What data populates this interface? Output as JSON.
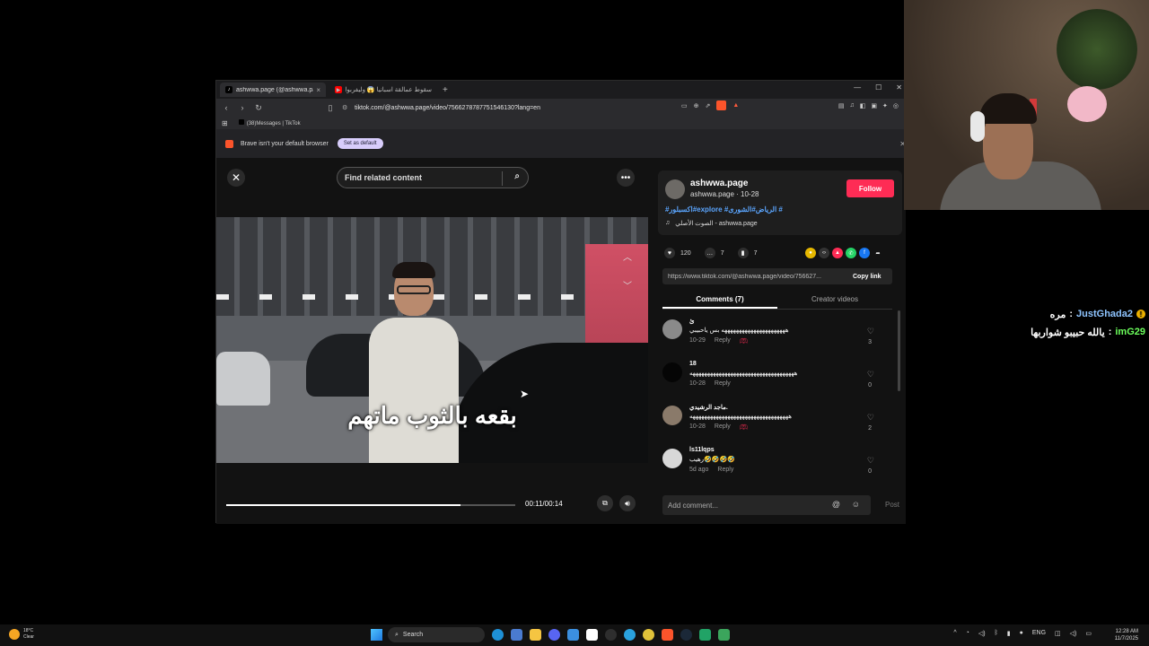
{
  "browser": {
    "tabs": [
      {
        "title": "ashwwa.page (@ashwwa.pa",
        "active": true
      },
      {
        "title": "سقوط عمالقة اسبانيا 😱 وليفربول يقد",
        "active": false
      }
    ],
    "new_tab": "+",
    "url": "tiktok.com/@ashwwa.page/video/7566278787751546130?lang=en",
    "bookmark": "(38)Messages | TikTok",
    "default_banner": {
      "message": "Brave isn't your default browser",
      "button": "Set as default"
    }
  },
  "video": {
    "search_placeholder": "Find related content",
    "caption": "بقعه بالثوب ماتهم",
    "time": "00:11/00:14",
    "progress": 0.81
  },
  "author": {
    "username": "ashwwa.page",
    "submeta": "ashwwa.page · 10-28",
    "follow_label": "Follow",
    "hashtags": "#اكسبلور#explore #الرياض#الشورى #",
    "sound": "الصوت الأصلي - ashwwa.page"
  },
  "stats": {
    "likes": "120",
    "comments": "7",
    "saves": "7"
  },
  "share": {
    "link": "https://www.tiktok.com/@ashwwa.page/video/756627...",
    "copy_label": "Copy link"
  },
  "panel_tabs": [
    {
      "label": "Comments (7)",
      "active": true
    },
    {
      "label": "Creator videos",
      "active": false
    }
  ],
  "comments": [
    {
      "name": "ئ",
      "text": "ههههههههههههههههههههههه بس ياحبيبي",
      "date": "10-29",
      "reply": "Reply",
      "likes": "3",
      "avatar_color": "#8a8a8a"
    },
    {
      "name": "18",
      "text": "ههههههههههههههههههههههههههههههههههههه",
      "date": "10-28",
      "reply": "Reply",
      "likes": "0",
      "avatar_color": "#050505"
    },
    {
      "name": "ماجد الرشيدي.",
      "text": "ههههههههههههههههههههههههههههههههههه",
      "date": "10-28",
      "reply": "Reply",
      "likes": "2",
      "avatar_color": "#8a7a6a"
    },
    {
      "name": "ls11lqps",
      "text": "رهيب🤣🤣🤣🤣",
      "date": "5d ago",
      "reply": "Reply",
      "likes": "0",
      "avatar_color": "#d8d8d8"
    }
  ],
  "comment_input": {
    "placeholder": "Add comment...",
    "post": "Post"
  },
  "chat": [
    {
      "user": "JustGhada2",
      "sep": " : ",
      "msg": "مره"
    },
    {
      "user": "imG29",
      "sep": " : ",
      "msg": "يالله حبيبو شواربها"
    }
  ],
  "taskbar": {
    "temp": "18°C",
    "condition": "Clear",
    "search": "Search",
    "lang": "ENG",
    "time": "12:28 AM",
    "date": "11/7/2025"
  }
}
